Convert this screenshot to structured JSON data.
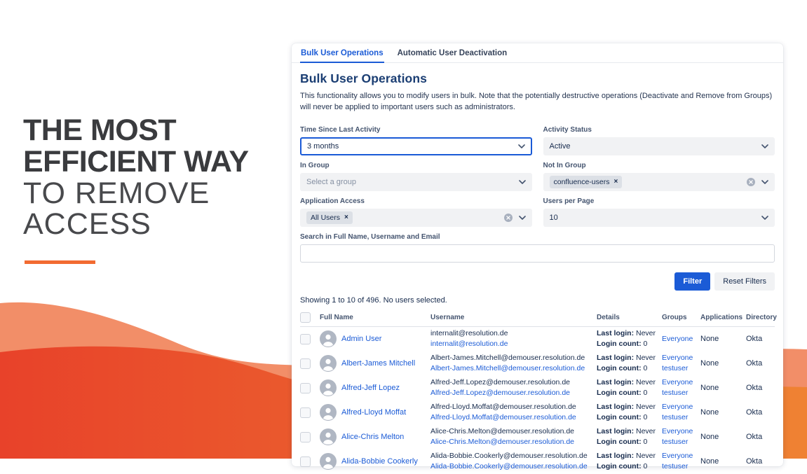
{
  "hero": {
    "line1": "THE MOST",
    "line2": "EFFICIENT WAY",
    "line3": "TO REMOVE",
    "line4": "ACCESS"
  },
  "colors": {
    "accent_blue": "#1B5BD6",
    "orange_accent": "#F26B31",
    "wave_light": "#F28E68",
    "wave_dark_left": "#E8422A",
    "wave_dark_right": "#EF8233"
  },
  "tabs": [
    {
      "label": "Bulk User Operations",
      "active": true
    },
    {
      "label": "Automatic User Deactivation",
      "active": false
    }
  ],
  "panel": {
    "title": "Bulk User Operations",
    "description": "This functionality allows you to modify users in bulk. Note that the potentially destructive operations (Deactivate and Remove from Groups) will never be applied to important users such as administrators."
  },
  "filters": {
    "time_since_label": "Time Since Last Activity",
    "time_since_value": "3 months",
    "activity_status_label": "Activity Status",
    "activity_status_value": "Active",
    "in_group_label": "In Group",
    "in_group_placeholder": "Select a group",
    "not_in_group_label": "Not In Group",
    "not_in_group_tag": "confluence-users",
    "app_access_label": "Application Access",
    "app_access_tag": "All Users",
    "users_per_page_label": "Users per Page",
    "users_per_page_value": "10",
    "search_label": "Search in Full Name, Username and Email",
    "filter_button": "Filter",
    "reset_button": "Reset Filters"
  },
  "icons": {
    "tag_remove": "×"
  },
  "summary": "Showing 1 to 10 of 496. No users selected.",
  "table": {
    "headers": [
      "Full Name",
      "Username",
      "Details",
      "Groups",
      "Applications",
      "Directory"
    ],
    "details_labels": {
      "last_login": "Last login:",
      "login_count": "Login count:"
    },
    "rows": [
      {
        "name": "Admin User",
        "username1": "internalit@resolution.de",
        "username2": "internalit@resolution.de",
        "last_login": "Never",
        "login_count": "0",
        "groups": [
          "Everyone"
        ],
        "applications": "None",
        "directory": "Okta"
      },
      {
        "name": "Albert-James Mitchell",
        "username1": "Albert-James.Mitchell@demouser.resolution.de",
        "username2": "Albert-James.Mitchell@demouser.resolution.de",
        "last_login": "Never",
        "login_count": "0",
        "groups": [
          "Everyone",
          "testuser"
        ],
        "applications": "None",
        "directory": "Okta"
      },
      {
        "name": "Alfred-Jeff Lopez",
        "username1": "Alfred-Jeff.Lopez@demouser.resolution.de",
        "username2": "Alfred-Jeff.Lopez@demouser.resolution.de",
        "last_login": "Never",
        "login_count": "0",
        "groups": [
          "Everyone",
          "testuser"
        ],
        "applications": "None",
        "directory": "Okta"
      },
      {
        "name": "Alfred-Lloyd Moffat",
        "username1": "Alfred-Lloyd.Moffat@demouser.resolution.de",
        "username2": "Alfred-Lloyd.Moffat@demouser.resolution.de",
        "last_login": "Never",
        "login_count": "0",
        "groups": [
          "Everyone",
          "testuser"
        ],
        "applications": "None",
        "directory": "Okta"
      },
      {
        "name": "Alice-Chris Melton",
        "username1": "Alice-Chris.Melton@demouser.resolution.de",
        "username2": "Alice-Chris.Melton@demouser.resolution.de",
        "last_login": "Never",
        "login_count": "0",
        "groups": [
          "Everyone",
          "testuser"
        ],
        "applications": "None",
        "directory": "Okta"
      },
      {
        "name": "Alida-Bobbie Cookerly",
        "username1": "Alida-Bobbie.Cookerly@demouser.resolution.de",
        "username2": "Alida-Bobbie.Cookerly@demouser.resolution.de",
        "last_login": "Never",
        "login_count": "0",
        "groups": [
          "Everyone",
          "testuser"
        ],
        "applications": "None",
        "directory": "Okta"
      }
    ]
  }
}
